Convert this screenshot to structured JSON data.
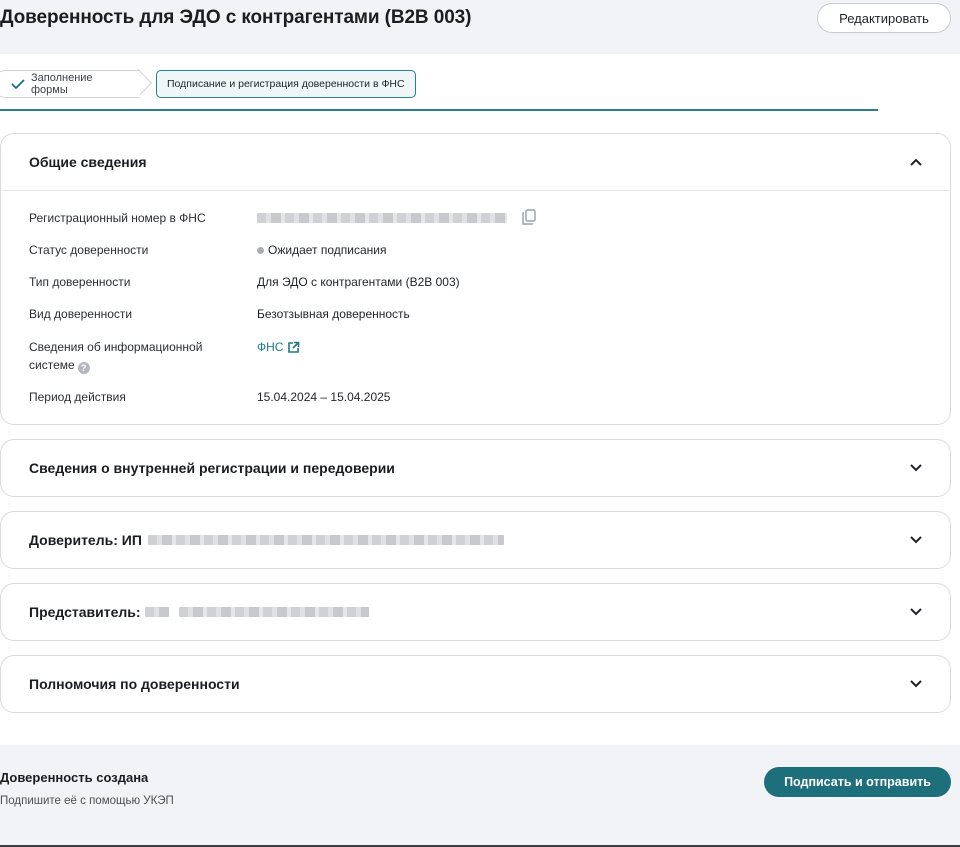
{
  "header": {
    "title": "Доверенность для ЭДО с контрагентами (B2B 003)",
    "edit_label": "Редактировать"
  },
  "stepper": {
    "steps": [
      {
        "label": "Заполнение формы",
        "state": "done"
      },
      {
        "label": "Подписание и регистрация доверенности в ФНС",
        "state": "active"
      }
    ],
    "accent_color": "#2a7d8a"
  },
  "general": {
    "title": "Общие сведения",
    "expanded": true,
    "rows": {
      "reg_number": {
        "label": "Регистрационный номер в ФНС",
        "value_hidden": true
      },
      "status": {
        "label": "Статус доверенности",
        "value": "Ожидает подписания"
      },
      "type": {
        "label": "Тип доверенности",
        "value": "Для ЭДО с контрагентами (B2B 003)"
      },
      "kind": {
        "label": "Вид доверенности",
        "value": "Безотзывная доверенность"
      },
      "info_system": {
        "label_line1": "Сведения об информационной",
        "label_line2": "системе",
        "value": "ФНС",
        "help_icon": "question-icon"
      },
      "period": {
        "label": "Период действия",
        "value": "15.04.2024 – 15.04.2025"
      }
    }
  },
  "sections": {
    "internal": {
      "title": "Сведения о внутренней регистрации и передоверии"
    },
    "principal": {
      "title": "Доверитель: ИП"
    },
    "representative": {
      "title": "Представитель:"
    },
    "powers": {
      "title": "Полномочия по доверенности"
    }
  },
  "footer": {
    "title": "Доверенность создана",
    "subtitle": "Подпишите её с помощью УКЭП",
    "sign_label": "Подписать и отправить"
  }
}
